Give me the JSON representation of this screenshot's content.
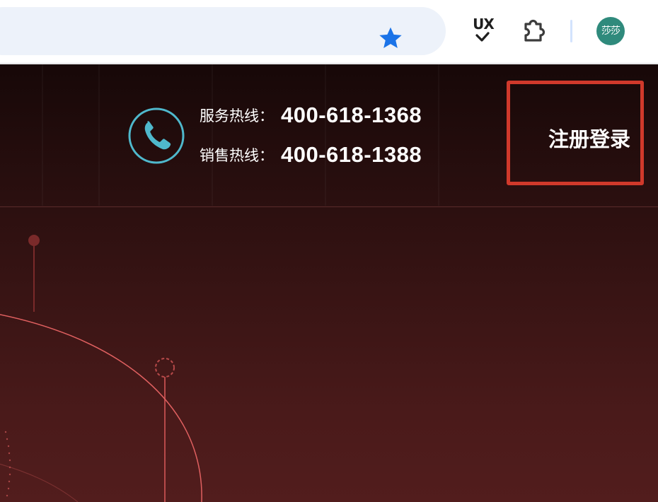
{
  "browser": {
    "bookmark_icon": "star-icon",
    "ux_extension": {
      "icon": "ux-check-icon",
      "text": "UX"
    },
    "extensions_icon": "puzzle-icon",
    "profile": {
      "initials": "莎莎",
      "color": "#2f8a7c"
    },
    "star_color": "#1a73e8",
    "omnibox_color": "#edf2fa"
  },
  "page": {
    "background_color": "#2a0f0f",
    "accent_color": "#d0392b",
    "phone_icon": "phone-icon",
    "phone_icon_color": "#4fb8cc",
    "hotlines": [
      {
        "label": "服务热线：",
        "number": "400-618-1368"
      },
      {
        "label": "销售热线：",
        "number": "400-618-1388"
      }
    ],
    "login": {
      "label": "注册登录"
    }
  }
}
